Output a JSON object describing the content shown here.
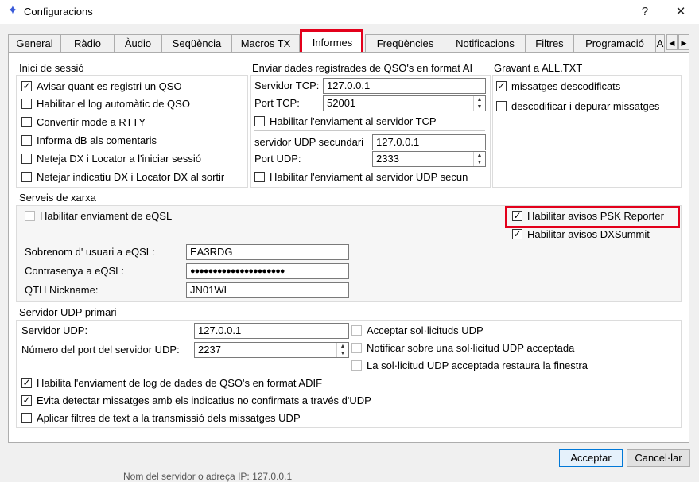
{
  "window": {
    "title": "Configuracions",
    "help_label": "?",
    "close_label": "✕",
    "icon": "star-app-icon"
  },
  "tabs": [
    "General",
    "Ràdio",
    "Àudio",
    "Seqüència",
    "Macros TX",
    "Informes",
    "Freqüències",
    "Notificacions",
    "Filtres",
    "Programació",
    "A"
  ],
  "active_tab": "Informes",
  "scroll": {
    "left": "◀",
    "right": "▶"
  },
  "login": {
    "title": "Inici de sessió",
    "items": [
      {
        "label": "Avisar quant es registri un QSO",
        "checked": true
      },
      {
        "label": "Habilitar el log automàtic de QSO",
        "checked": false
      },
      {
        "label": "Convertir mode a RTTY",
        "checked": false
      },
      {
        "label": "Informa dB als comentaris",
        "checked": false
      },
      {
        "label": "Neteja DX i Locator a l'iniciar sessió",
        "checked": false
      },
      {
        "label": "Netejar indicatiu DX i Locator DX al sortir",
        "checked": false
      }
    ]
  },
  "send": {
    "title": "Enviar dades registrades de QSO's en format AI",
    "tcp_server_label": "Servidor TCP:",
    "tcp_server_value": "127.0.0.1",
    "tcp_port_label": "Port TCP:",
    "tcp_port_value": "52001",
    "tcp_enable_label": "Habilitar l'enviament al servidor TCP",
    "udp_secondary_label": "servidor UDP secundari",
    "udp_secondary_value": "127.0.0.1",
    "udp_port_label": "Port UDP:",
    "udp_port_value": "2333",
    "udp_enable_label": "Habilitar l'enviament al servidor UDP secun"
  },
  "alltxt": {
    "title": "Gravant a ALL.TXT",
    "items": [
      {
        "label": "missatges descodificats",
        "checked": true
      },
      {
        "label": "descodificar i depurar missatges",
        "checked": false
      }
    ]
  },
  "network": {
    "title": "Serveis de xarxa",
    "eqsl_enable_label": "Habilitar enviament de eQSL",
    "psk_label": "Habilitar avisos PSK Reporter",
    "dxsummit_label": "Habilitar avisos DXSummit",
    "user_label": "Sobrenom d' usuari a eQSL:",
    "user_value": "EA3RDG",
    "password_label": "Contrasenya a eQSL:",
    "password_value": "●●●●●●●●●●●●●●●●●●●●●",
    "qth_label": "QTH Nickname:",
    "qth_value": "JN01WL"
  },
  "udp": {
    "title": "Servidor UDP primari",
    "server_label": "Servidor UDP:",
    "server_value": "127.0.0.1",
    "port_label": "Número del port del servidor UDP:",
    "port_value": "2237",
    "accept_label": "Acceptar sol·licituds UDP",
    "notify_label": "Notificar sobre una sol·licitud UDP acceptada",
    "restore_label": "La sol·licitud UDP acceptada restaura la finestra",
    "adif_label": "Habilita l'enviament de log de dades de QSO's en format ADIF",
    "avoid_label": "Evita detectar missatges amb els indicatius no confirmats a través d'UDP",
    "filters_label": "Aplicar filtres de text a la transmissió dels missatges UDP"
  },
  "buttons": {
    "accept": "Acceptar",
    "cancel": "Cancel·lar"
  },
  "behind_text": "Nom del servidor o adreça IP:  127.0.0.1",
  "colors": {
    "highlight": "#e3001b",
    "accent": "#0078d7"
  }
}
